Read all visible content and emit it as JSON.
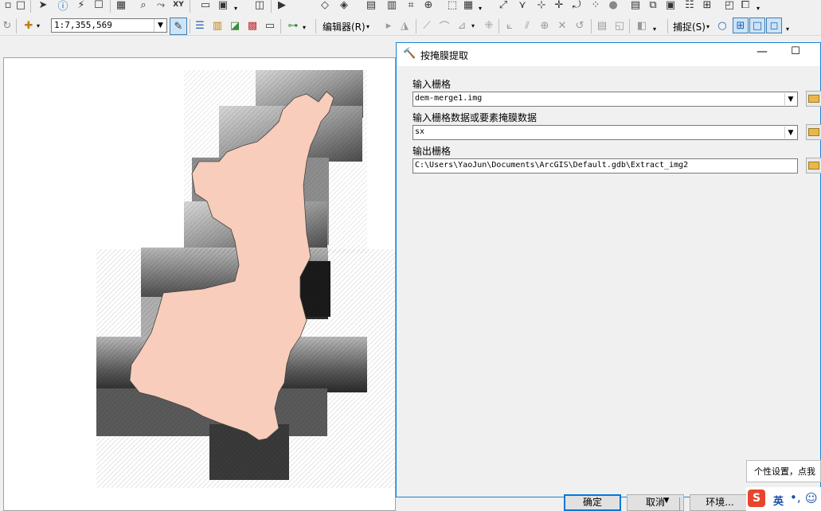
{
  "toolbar": {
    "scale_value": "1:7,355,569",
    "editor_label": "编辑器(R)",
    "snap_label": "捕捉(S)"
  },
  "dialog": {
    "title": "按掩膜提取",
    "input_raster_label": "输入栅格",
    "input_raster_value": "dem-merge1.img",
    "mask_label": "输入栅格数据或要素掩膜数据",
    "mask_value": "sx",
    "output_label": "输出栅格",
    "output_value": "C:\\Users\\YaoJun\\Documents\\ArcGIS\\Default.gdb\\Extract_img2",
    "ok_label": "确定",
    "cancel_label": "取消",
    "env_label": "环境..."
  },
  "tooltip": {
    "text": "个性设置，点我"
  },
  "ime": {
    "lang": "英",
    "punct": "•,",
    "logo": "S"
  },
  "map": {
    "region_fill": "#f9cdbb",
    "dem_dark": "#222222",
    "dem_light": "#e6e6e6"
  }
}
